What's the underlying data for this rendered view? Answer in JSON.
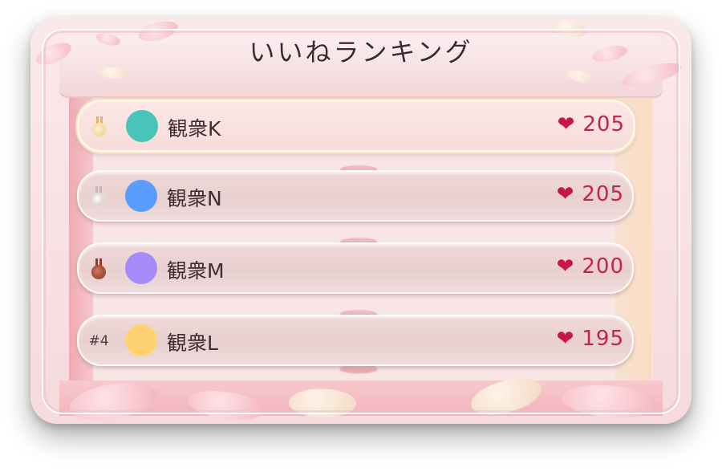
{
  "title": "いいねランキング",
  "colors": {
    "heart": "#c8154a",
    "count": "#c2234f",
    "card_background": "#f8e6e7"
  },
  "ranking": [
    {
      "rank_icon": "gold-medal-icon",
      "rank_label": "",
      "avatar_color": "#48c4b9",
      "name": "観衆K",
      "heart": "❤",
      "likes": "205"
    },
    {
      "rank_icon": "silver-medal-icon",
      "rank_label": "",
      "avatar_color": "#5b9dff",
      "name": "観衆N",
      "heart": "❤",
      "likes": "205"
    },
    {
      "rank_icon": "bronze-medal-icon",
      "rank_label": "",
      "avatar_color": "#a68af8",
      "name": "観衆M",
      "heart": "❤",
      "likes": "200"
    },
    {
      "rank_icon": "",
      "rank_label": "#4",
      "avatar_color": "#ffd271",
      "name": "観衆L",
      "heart": "❤",
      "likes": "195"
    }
  ]
}
